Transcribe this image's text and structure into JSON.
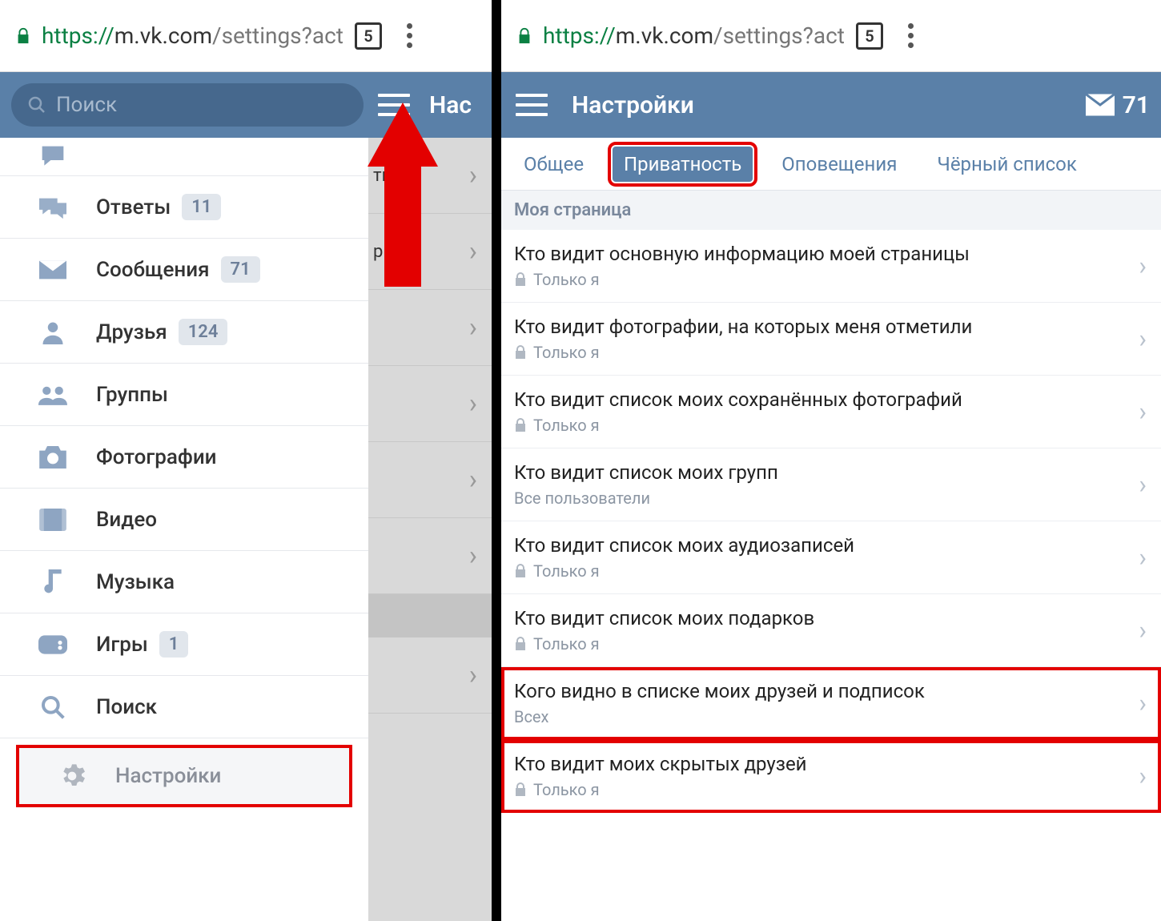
{
  "browser": {
    "protocol": "https://",
    "host_underlined": "m.vk.com",
    "path": "/settings?act",
    "tab_count": "5"
  },
  "left": {
    "search_placeholder": "Поиск",
    "title_clip": "Нас",
    "sidebar": [
      {
        "label": "",
        "count": "",
        "icon": "speech"
      },
      {
        "label": "Ответы",
        "count": "11",
        "icon": "replies"
      },
      {
        "label": "Сообщения",
        "count": "71",
        "icon": "mail"
      },
      {
        "label": "Друзья",
        "count": "124",
        "icon": "friend"
      },
      {
        "label": "Группы",
        "count": "",
        "icon": "groups"
      },
      {
        "label": "Фотографии",
        "count": "",
        "icon": "photo"
      },
      {
        "label": "Видео",
        "count": "",
        "icon": "video"
      },
      {
        "label": "Музыка",
        "count": "",
        "icon": "music"
      },
      {
        "label": "Игры",
        "count": "1",
        "icon": "games"
      },
      {
        "label": "Поиск",
        "count": "",
        "icon": "search"
      },
      {
        "label": "Настройки",
        "count": "",
        "icon": "gear"
      }
    ],
    "obscured_text_1": "тил",
    "obscured_text_2": "ри"
  },
  "right": {
    "title": "Настройки",
    "mail_count": "71",
    "tabs": [
      "Общее",
      "Приватность",
      "Оповещения",
      "Чёрный список"
    ],
    "section": "Моя страница",
    "rows": [
      {
        "title": "Кто видит основную информацию моей страницы",
        "sub": "Только я",
        "lock": true
      },
      {
        "title": "Кто видит фотографии, на которых меня отметили",
        "sub": "Только я",
        "lock": true
      },
      {
        "title": "Кто видит список моих сохранённых фотографий",
        "sub": "Только я",
        "lock": true
      },
      {
        "title": "Кто видит список моих групп",
        "sub": "Все пользователи",
        "lock": false
      },
      {
        "title": "Кто видит список моих аудиозаписей",
        "sub": "Только я",
        "lock": true
      },
      {
        "title": "Кто видит список моих подарков",
        "sub": "Только я",
        "lock": true
      },
      {
        "title": "Кого видно в списке моих друзей и подписок",
        "sub": "Всех",
        "lock": false,
        "hl": true
      },
      {
        "title": "Кто видит моих скрытых друзей",
        "sub": "Только я",
        "lock": true,
        "hl": true
      }
    ]
  }
}
